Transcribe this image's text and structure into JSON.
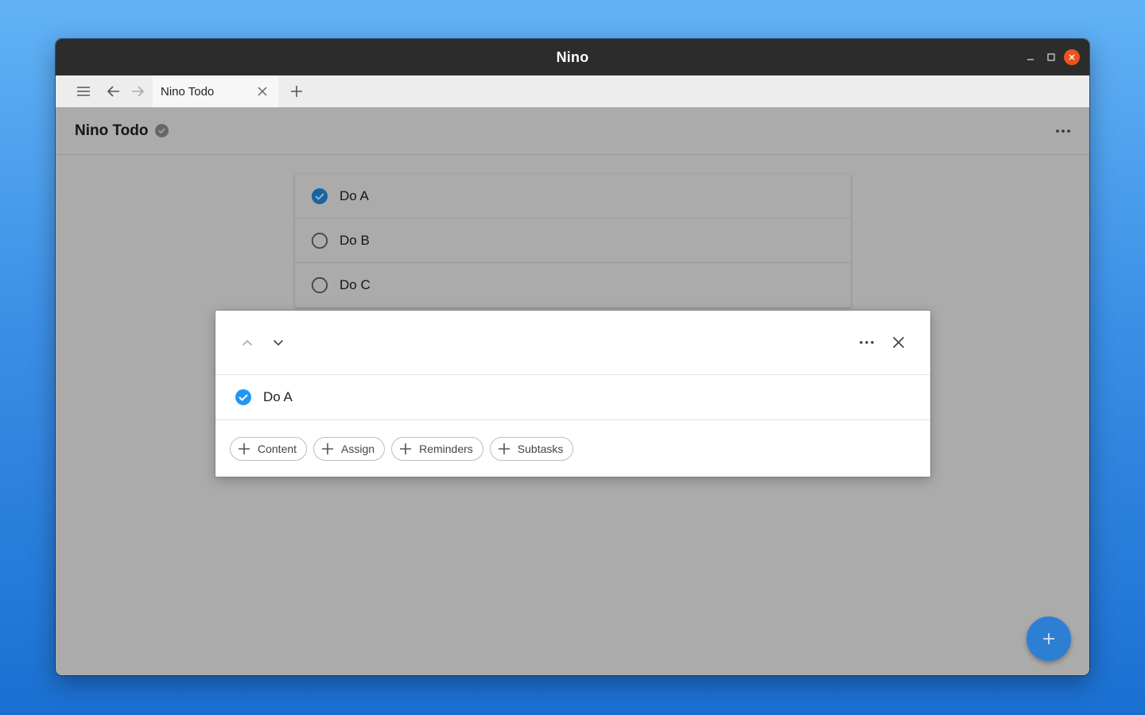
{
  "window": {
    "title": "Nino"
  },
  "tabbar": {
    "tab_title": "Nino Todo"
  },
  "page": {
    "title": "Nino Todo"
  },
  "todos": [
    {
      "label": "Do A",
      "done": true
    },
    {
      "label": "Do B",
      "done": false
    },
    {
      "label": "Do C",
      "done": false
    }
  ],
  "dialog": {
    "task_label": "Do A",
    "task_done": true,
    "actions": [
      "Content",
      "Assign",
      "Reminders",
      "Subtasks"
    ]
  },
  "colors": {
    "accent": "#2d7fd4",
    "check_blue": "#2196f3",
    "close_button": "#e95420"
  },
  "icons": {
    "fab": "plus-icon",
    "menu": "hamburger-icon"
  }
}
